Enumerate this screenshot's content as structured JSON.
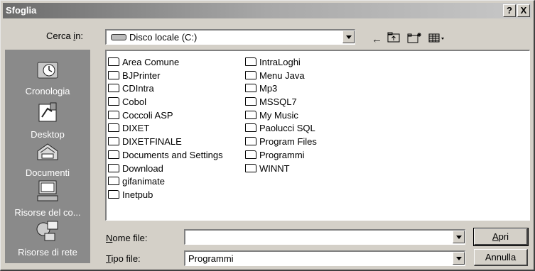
{
  "dialog": {
    "title": "Sfoglia",
    "help_glyph": "?",
    "close_glyph": "X"
  },
  "lookin": {
    "label_pre": "Cerca ",
    "label_accel": "i",
    "label_post": "n:",
    "value": "Disco locale (C:)"
  },
  "toolbar": {
    "back_icon": "back-arrow-icon",
    "up_icon": "up-folder-icon",
    "new_folder_icon": "new-folder-icon",
    "view_icon": "view-menu-icon"
  },
  "places": [
    {
      "label": "Cronologia",
      "icon": "history-icon"
    },
    {
      "label": "Desktop",
      "icon": "desktop-icon"
    },
    {
      "label": "Documenti",
      "icon": "documents-icon"
    },
    {
      "label": "Risorse del co...",
      "icon": "my-computer-icon"
    },
    {
      "label": "Risorse di rete",
      "icon": "network-icon"
    }
  ],
  "files": {
    "column1": [
      "Area Comune",
      "BJPrinter",
      "CDIntra",
      "Cobol",
      "Coccoli ASP",
      "DIXET",
      "DIXETFINALE",
      "Documents and Settings",
      "Download",
      "gifanimate",
      "Inetpub"
    ],
    "column2": [
      "IntraLoghi",
      "Menu Java",
      "Mp3",
      "MSSQL7",
      "My Music",
      "Paolucci SQL",
      "Program Files",
      "Programmi",
      "WINNT"
    ]
  },
  "filename": {
    "label_accel": "N",
    "label_post": "ome file:",
    "value": ""
  },
  "filetype": {
    "label_accel": "T",
    "label_post": "ipo file:",
    "value": "Programmi"
  },
  "buttons": {
    "open_accel": "A",
    "open_post": "pri",
    "cancel": "Annulla"
  }
}
